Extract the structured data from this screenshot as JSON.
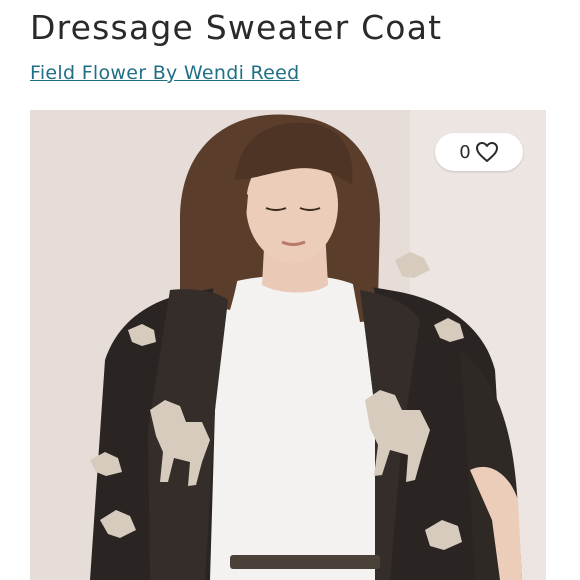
{
  "listing": {
    "title": "Dressage Sweater Coat",
    "brand": "Field Flower By Wendi Reed"
  },
  "likes": {
    "count": "0",
    "icon": "heart-outline-icon"
  },
  "photo": {
    "subject": "product-photo",
    "background_color": "#e4dbd6",
    "coat_color": "#2a2523",
    "pattern_color": "#d6cbbd",
    "shirt_color": "#f3f2f0",
    "hair_color": "#5b3d2b"
  }
}
